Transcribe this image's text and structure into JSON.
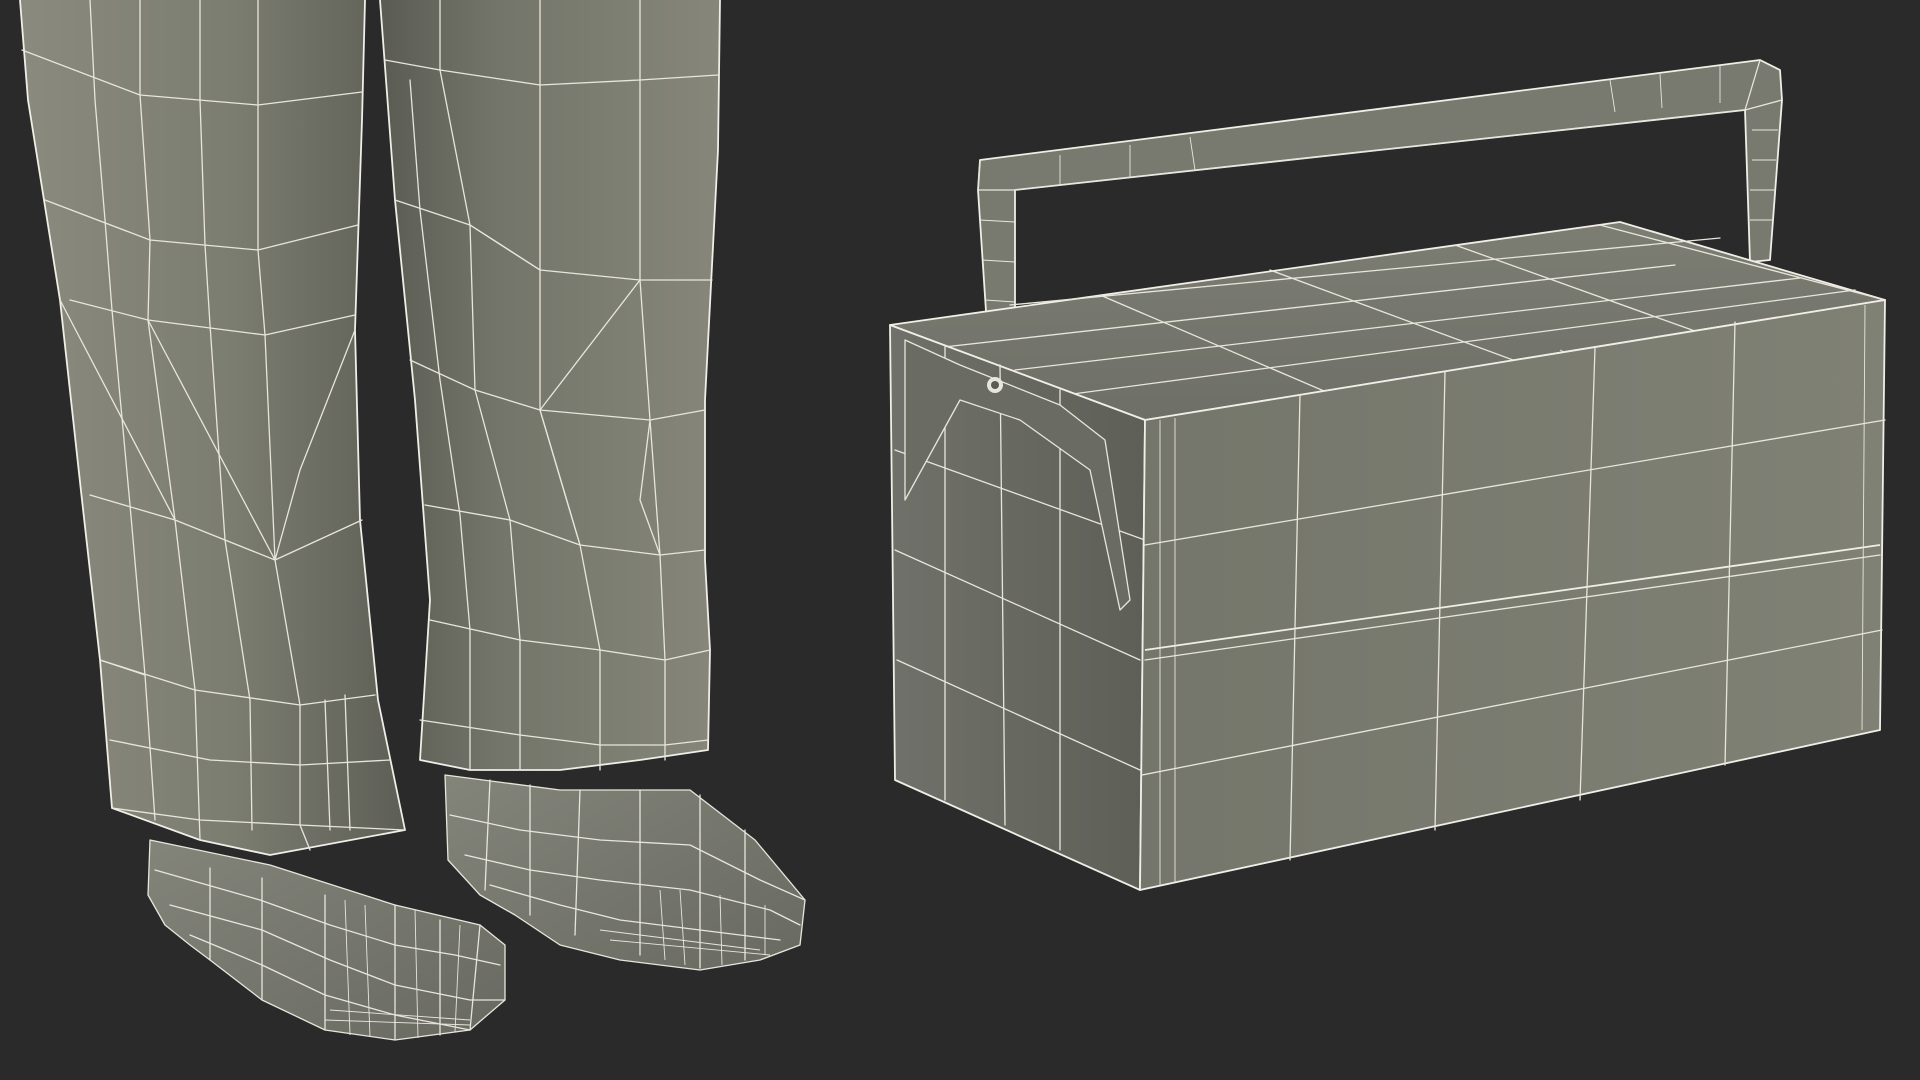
{
  "scene": {
    "background": "#2a2a2a",
    "mesh_face_color": "#7b7c70",
    "mesh_face_shadow": "#5f6056",
    "mesh_face_light": "#878879",
    "wire_color": "#e8e6dc",
    "objects": [
      {
        "name": "trouser-legs-and-boots",
        "display": "wireframe-on-shaded"
      },
      {
        "name": "cantilever-toolbox",
        "display": "wireframe-on-shaded"
      }
    ]
  }
}
